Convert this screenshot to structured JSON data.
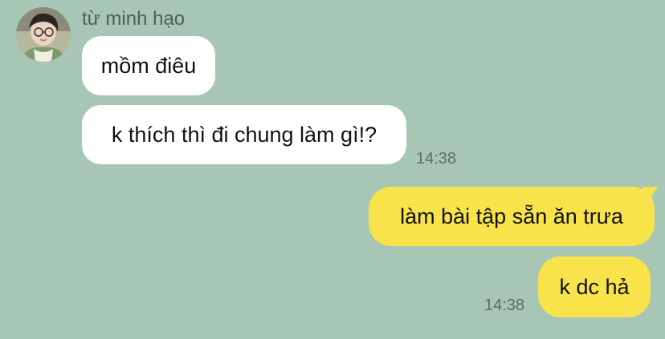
{
  "conversation": {
    "contact_name": "từ minh hạo",
    "incoming": [
      {
        "text": "mồm điêu"
      },
      {
        "text": "k thích thì đi chung làm gì!?",
        "time": "14:38"
      }
    ],
    "outgoing": [
      {
        "text": "làm bài tập sẵn ăn trưa"
      },
      {
        "text": "k dc hả",
        "time": "14:38"
      }
    ]
  },
  "colors": {
    "background": "#a7c6b5",
    "incoming_bubble": "#ffffff",
    "outgoing_bubble": "#f8e34a",
    "timestamp": "#5d6e65"
  }
}
